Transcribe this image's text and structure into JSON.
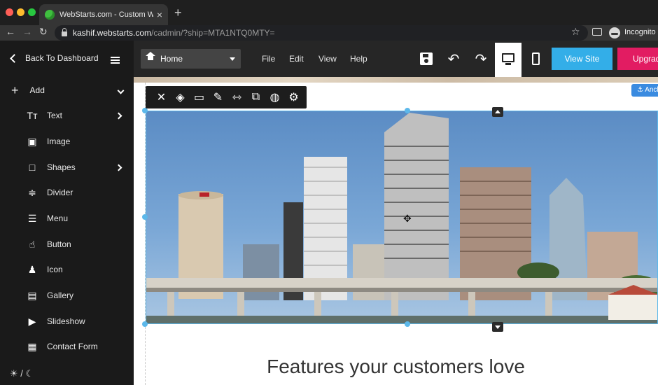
{
  "browser": {
    "tab_title": "WebStarts.com - Custom Web",
    "tab_close": "×",
    "new_tab": "+",
    "back": "←",
    "forward": "→",
    "reload": "↻",
    "url_host": "kashif.webstarts.com",
    "url_path": "/cadmin/?ship=MTA1NTQ0MTY=",
    "bookmark": "☆",
    "profile_label": "Incognito"
  },
  "toolbar": {
    "page_select": "Home",
    "menus": [
      "File",
      "Edit",
      "View",
      "Help"
    ],
    "undo": "↶",
    "redo": "↷",
    "view_site": "View Site",
    "upgrade": "Upgrad"
  },
  "sidebar": {
    "back_label": "Back To Dashboard",
    "add_label": "Add",
    "add_glyph": "+",
    "items": [
      {
        "label": "Text",
        "icon": "Tт",
        "has_submenu": true
      },
      {
        "label": "Image",
        "icon": "▣",
        "has_submenu": false
      },
      {
        "label": "Shapes",
        "icon": "□",
        "has_submenu": true
      },
      {
        "label": "Divider",
        "icon": "≑",
        "has_submenu": false
      },
      {
        "label": "Menu",
        "icon": "☰",
        "has_submenu": false
      },
      {
        "label": "Button",
        "icon": "☝",
        "has_submenu": false
      },
      {
        "label": "Icon",
        "icon": "♟",
        "has_submenu": false
      },
      {
        "label": "Gallery",
        "icon": "▤",
        "has_submenu": false
      },
      {
        "label": "Slideshow",
        "icon": "▶",
        "has_submenu": false
      },
      {
        "label": "Contact Form",
        "icon": "▦",
        "has_submenu": false
      }
    ],
    "theme_toggle": "☀ / ☾"
  },
  "element_toolbar": {
    "icons": [
      "✕",
      "◈",
      "▭",
      "✎",
      "⇿",
      "⧉",
      "◍",
      "⚙"
    ]
  },
  "canvas": {
    "anchor_label": "⚓ Anch",
    "heading": "Features your customers love",
    "move_cursor": "✥"
  },
  "colors": {
    "view_site": "#33aee8",
    "upgrade": "#e21c62",
    "selection": "#5cb8ea"
  }
}
